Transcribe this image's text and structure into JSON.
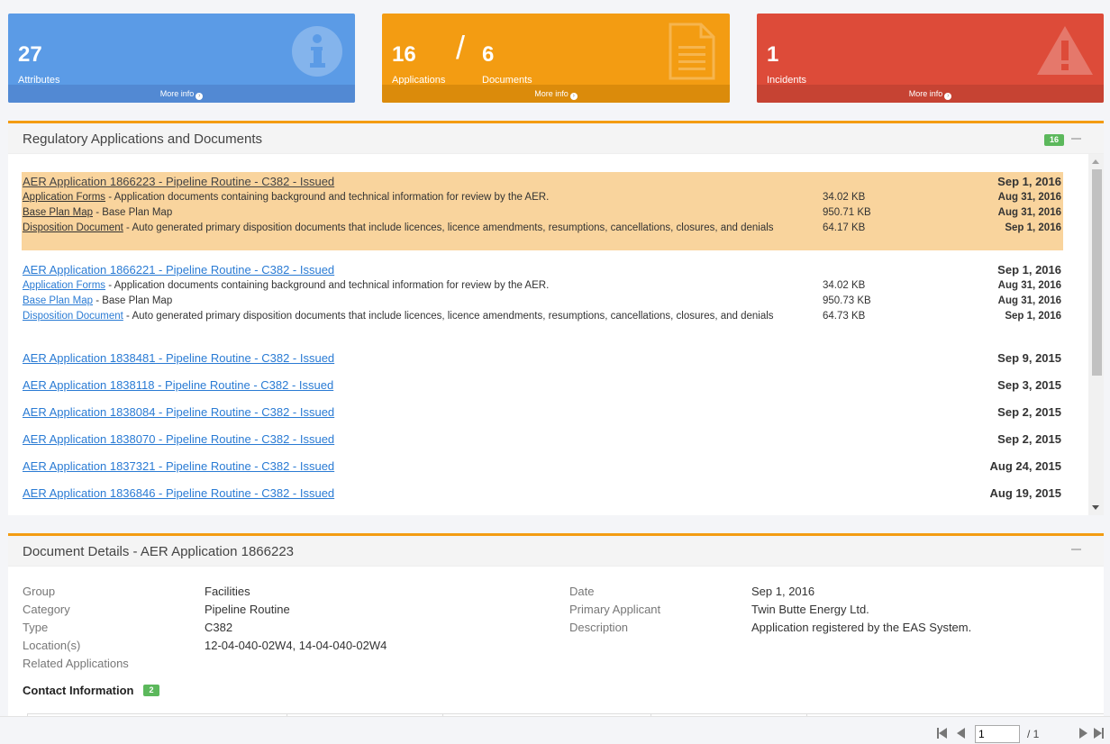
{
  "stats": {
    "attributes": {
      "count": "27",
      "label": "Attributes",
      "more": "More info"
    },
    "applications": {
      "count": "16",
      "label": "Applications",
      "more": "More info"
    },
    "documents": {
      "count": "6",
      "label": "Documents"
    },
    "incidents": {
      "count": "1",
      "label": "Incidents",
      "more": "More info"
    },
    "slash": "/"
  },
  "apps_panel": {
    "title": "Regulatory Applications and Documents",
    "badge": "16",
    "applications": [
      {
        "title": "AER Application 1866223 - Pipeline Routine - C382 - Issued",
        "date": "Sep 1, 2016",
        "highlighted": true,
        "documents": [
          {
            "link": "Application Forms",
            "desc": " - Application documents containing background and technical information for review by the AER.",
            "size": "34.02 KB",
            "date": "Aug 31, 2016"
          },
          {
            "link": "Base Plan Map",
            "desc": " - Base Plan Map",
            "size": "950.71 KB",
            "date": "Aug 31, 2016"
          },
          {
            "link": "Disposition Document",
            "desc": " - Auto generated primary disposition documents that include licences, licence amendments, resumptions, cancellations, closures, and denials",
            "size": "64.17 KB",
            "date": "Sep 1, 2016"
          }
        ]
      },
      {
        "title": "AER Application 1866221 - Pipeline Routine - C382 - Issued",
        "date": "Sep 1, 2016",
        "highlighted": false,
        "documents": [
          {
            "link": "Application Forms",
            "desc": " - Application documents containing background and technical information for review by the AER.",
            "size": "34.02 KB",
            "date": "Aug 31, 2016"
          },
          {
            "link": "Base Plan Map",
            "desc": " - Base Plan Map",
            "size": "950.73 KB",
            "date": "Aug 31, 2016"
          },
          {
            "link": "Disposition Document",
            "desc": " - Auto generated primary disposition documents that include licences, licence amendments, resumptions, cancellations, closures, and denials",
            "size": "64.73 KB",
            "date": "Sep 1, 2016"
          }
        ]
      },
      {
        "title": "AER Application 1838481 - Pipeline Routine - C382 - Issued",
        "date": "Sep 9, 2015"
      },
      {
        "title": "AER Application 1838118 - Pipeline Routine - C382 - Issued",
        "date": "Sep 3, 2015"
      },
      {
        "title": "AER Application 1838084 - Pipeline Routine - C382 - Issued",
        "date": "Sep 2, 2015"
      },
      {
        "title": "AER Application 1838070 - Pipeline Routine - C382 - Issued",
        "date": "Sep 2, 2015"
      },
      {
        "title": "AER Application 1837321 - Pipeline Routine - C382 - Issued",
        "date": "Aug 24, 2015"
      },
      {
        "title": "AER Application 1836846 - Pipeline Routine - C382 - Issued",
        "date": "Aug 19, 2015"
      }
    ]
  },
  "details_panel": {
    "title": "Document Details - AER Application 1866223",
    "fields_left": [
      {
        "label": "Group",
        "value": "Facilities"
      },
      {
        "label": "Category",
        "value": "Pipeline Routine"
      },
      {
        "label": "Type",
        "value": "C382"
      },
      {
        "label": "Location(s)",
        "value": "12-04-040-02W4, 14-04-040-02W4"
      },
      {
        "label": "Related Applications",
        "value": ""
      }
    ],
    "fields_right": [
      {
        "label": "Date",
        "value": "Sep 1, 2016"
      },
      {
        "label": "Primary Applicant",
        "value": "Twin Butte Energy Ltd."
      },
      {
        "label": "Description",
        "value": "Application registered by the EAS System."
      }
    ],
    "contact_title": "Contact Information",
    "contact_badge": "2"
  },
  "pager": {
    "page": "1",
    "total": "/ 1"
  },
  "colors": {
    "blue": "#5b9be6",
    "orange": "#f39c12",
    "red": "#dd4b39",
    "highlight": "#f9d49d",
    "link": "#2a7bd4",
    "badge": "#5cb85c"
  }
}
